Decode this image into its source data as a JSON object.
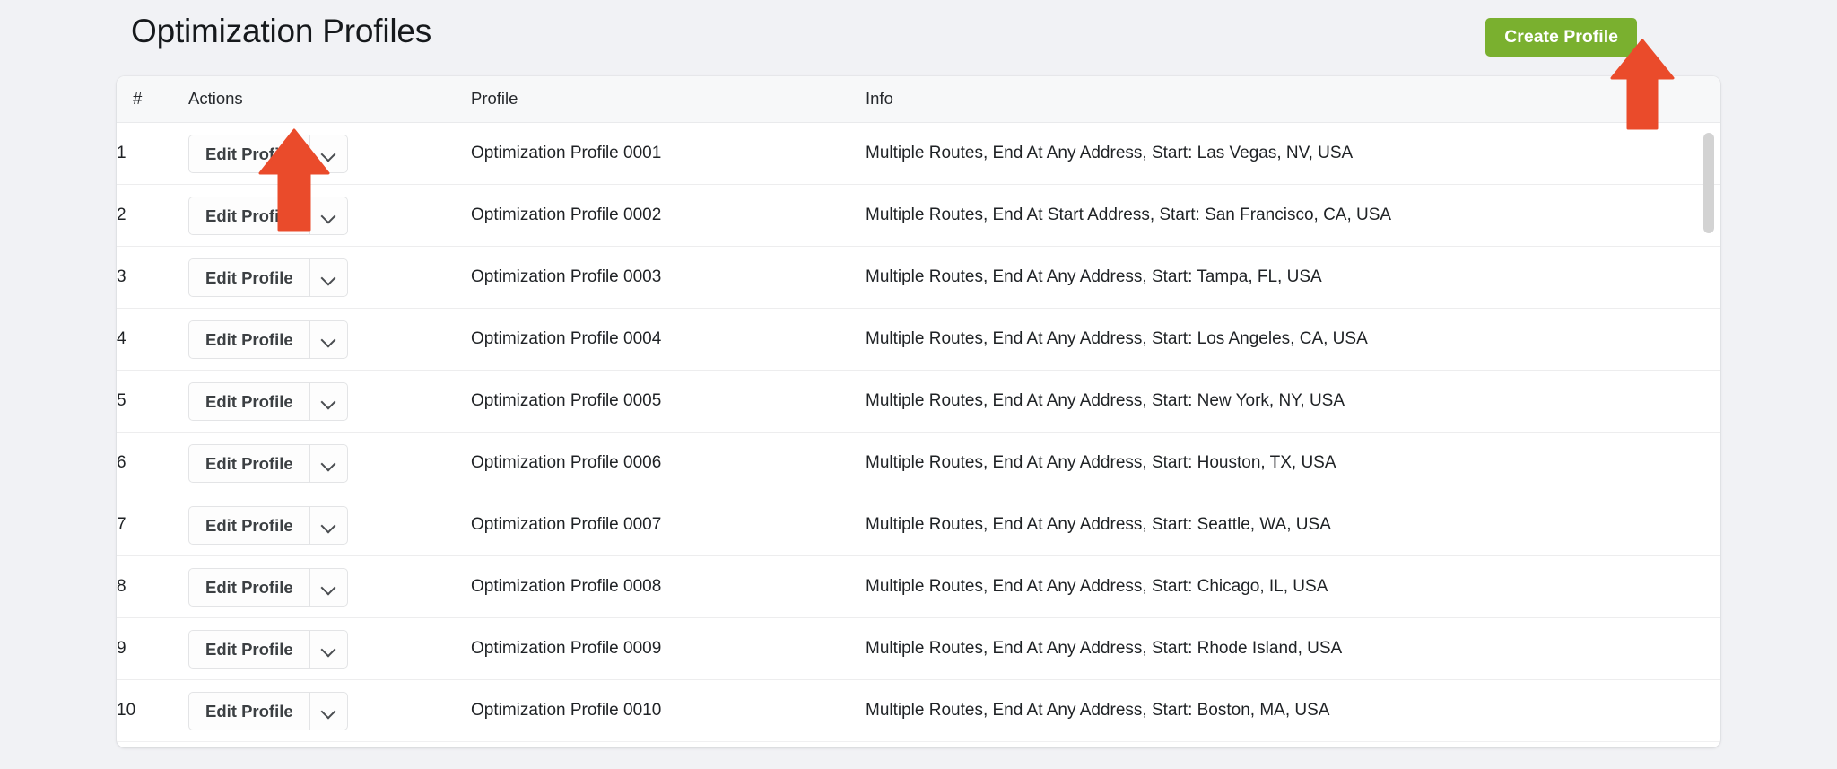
{
  "header": {
    "title": "Optimization Profiles",
    "create_button_label": "Create Profile"
  },
  "colors": {
    "page_background": "#f1f2f5",
    "card_background": "#ffffff",
    "create_button_green": "#7ab02f",
    "arrow_red": "#ea4b2b",
    "header_row_background": "#f7f8f9",
    "row_border": "#ededee",
    "scrollbar_thumb": "#d3d3d3",
    "text_primary": "#1f2225"
  },
  "table": {
    "columns": [
      {
        "key": "num",
        "label": "#"
      },
      {
        "key": "actions",
        "label": "Actions"
      },
      {
        "key": "profile",
        "label": "Profile"
      },
      {
        "key": "info",
        "label": "Info"
      }
    ],
    "action_button_label": "Edit Profile",
    "action_caret_icon": "chevron-down-icon",
    "rows": [
      {
        "num": "1",
        "action_label": "Edit Profile",
        "profile": "Optimization Profile 0001",
        "info": "Multiple Routes, End At Any Address, Start: Las Vegas, NV, USA"
      },
      {
        "num": "2",
        "action_label": "Edit Profile",
        "profile": "Optimization Profile 0002",
        "info": "Multiple Routes, End At Start Address, Start: San Francisco, CA, USA"
      },
      {
        "num": "3",
        "action_label": "Edit Profile",
        "profile": "Optimization Profile 0003",
        "info": "Multiple Routes, End At Any Address, Start: Tampa, FL, USA"
      },
      {
        "num": "4",
        "action_label": "Edit Profile",
        "profile": "Optimization Profile 0004",
        "info": "Multiple Routes, End At Any Address, Start: Los Angeles, CA, USA"
      },
      {
        "num": "5",
        "action_label": "Edit Profile",
        "profile": "Optimization Profile 0005",
        "info": "Multiple Routes, End At Any Address, Start: New York, NY, USA"
      },
      {
        "num": "6",
        "action_label": "Edit Profile",
        "profile": "Optimization Profile 0006",
        "info": "Multiple Routes, End At Any Address, Start: Houston, TX, USA"
      },
      {
        "num": "7",
        "action_label": "Edit Profile",
        "profile": "Optimization Profile 0007",
        "info": "Multiple Routes, End At Any Address, Start: Seattle, WA, USA"
      },
      {
        "num": "8",
        "action_label": "Edit Profile",
        "profile": "Optimization Profile 0008",
        "info": "Multiple Routes, End At Any Address, Start: Chicago, IL, USA"
      },
      {
        "num": "9",
        "action_label": "Edit Profile",
        "profile": "Optimization Profile 0009",
        "info": "Multiple Routes, End At Any Address, Start: Rhode Island, USA"
      },
      {
        "num": "10",
        "action_label": "Edit Profile",
        "profile": "Optimization Profile 0010",
        "info": "Multiple Routes, End At Any Address, Start: Boston, MA, USA"
      }
    ]
  },
  "annotations": [
    {
      "name": "arrow-pointing-to-create-profile-button",
      "icon": "up-arrow-icon"
    },
    {
      "name": "arrow-pointing-to-edit-profile-button",
      "icon": "up-arrow-icon"
    }
  ]
}
